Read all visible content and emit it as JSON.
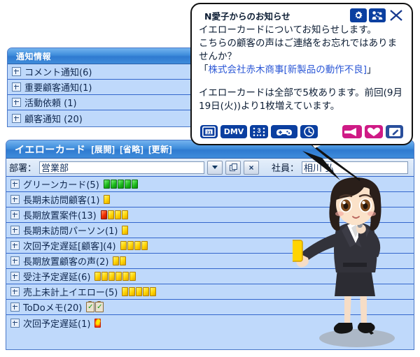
{
  "notification_panel": {
    "title": "通知情報",
    "rows": [
      {
        "label": "コメント通知(6)",
        "badges": []
      },
      {
        "label": "重要顧客通知(1)",
        "badges": []
      },
      {
        "label": "活動依頼 (1)",
        "badges": []
      },
      {
        "label": "顧客通知 (20)",
        "badges": []
      }
    ]
  },
  "yellow_card_panel": {
    "title": "イエローカード",
    "header_links": [
      "[展開]",
      "[省略]",
      "[更新]"
    ],
    "toolbar": {
      "dept_label": "部署：",
      "dept_value": "営業部",
      "dept_dropdown_icon": "chevron-down-icon",
      "copy_icon": "copy-icon",
      "clear_label": "×",
      "emp_label": "社員：",
      "emp_value": "相川 弘"
    },
    "rows": [
      {
        "label": "グリーンカード(5)",
        "badges": [
          "green",
          "green",
          "green",
          "green",
          "green"
        ]
      },
      {
        "label": "長期未訪問顧客(1)",
        "badges": [
          "yellow"
        ]
      },
      {
        "label": "長期放置案件(13)",
        "badges": [
          "red",
          "yellow",
          "yellow",
          "yellow"
        ]
      },
      {
        "label": "長期未訪問パーソン(1)",
        "badges": [
          "yellow"
        ]
      },
      {
        "label": "次回予定遅延[顧客](4)",
        "badges": [
          "yellow",
          "yellow",
          "yellow",
          "yellow"
        ]
      },
      {
        "label": "長期放置顧客の声(2)",
        "badges": [
          "yellow",
          "yellow"
        ]
      },
      {
        "label": "受注予定遅延(6)",
        "badges": [
          "yellow",
          "yellow",
          "yellow",
          "yellow",
          "yellow",
          "yellow"
        ]
      },
      {
        "label": "売上未計上イエロー(5)",
        "badges": [
          "yellow",
          "yellow",
          "yellow",
          "yellow",
          "yellow"
        ]
      },
      {
        "label": "ToDoメモ(20)",
        "badges": [
          "clip",
          "clip"
        ]
      },
      {
        "label": "次回予定遅延(1)",
        "badges": [
          "burst"
        ]
      }
    ]
  },
  "speech_bubble": {
    "title": "N愛子からのお知らせ",
    "titlebar_buttons": [
      {
        "name": "settings-icon",
        "glyph": "✿"
      },
      {
        "name": "switch-user-icon",
        "glyph": "👤"
      },
      {
        "name": "close-icon",
        "glyph": "✕"
      }
    ],
    "line1": "イエローカードについてお知らせします。",
    "line2": "こちらの顧客の声はご連絡をお忘れではありま",
    "line3": "せんか？",
    "line4_open": "「",
    "line4_link": "株式会社赤木商事[新製品の動作不良]",
    "line4_close": "」",
    "line5": "イエローカードは全部で5枚あります。前回(9月",
    "line6": "19日(火))より1枚増えています。",
    "action_icons_left": [
      {
        "name": "calendar-icon",
        "label": "31"
      },
      {
        "name": "dmv-icon",
        "label": "DMV"
      },
      {
        "name": "dice-icon",
        "label": "⁙3⁙"
      },
      {
        "name": "gamepad-icon",
        "label": "🎮"
      },
      {
        "name": "clock-icon",
        "label": "◔"
      }
    ],
    "action_icons_right": [
      {
        "name": "megaphone-icon",
        "label": "📣",
        "color": "#cf1b86"
      },
      {
        "name": "heart-icon",
        "label": "♥",
        "color": "#cf1b86"
      },
      {
        "name": "edit-icon",
        "label": "✎",
        "color": "#2a4f9c"
      }
    ]
  },
  "character": {
    "name": "chibi-referee-avatar",
    "description": "businesswoman holding yellow card and whistle"
  },
  "colors": {
    "panel_header_blue": "#3f8ddb",
    "row_background": "#bfd9fb",
    "row_divider": "#3366cc",
    "bubble_button_blue": "#0b3fa0",
    "pink_accent": "#cf1b86",
    "link_blue": "#2b57d6"
  }
}
